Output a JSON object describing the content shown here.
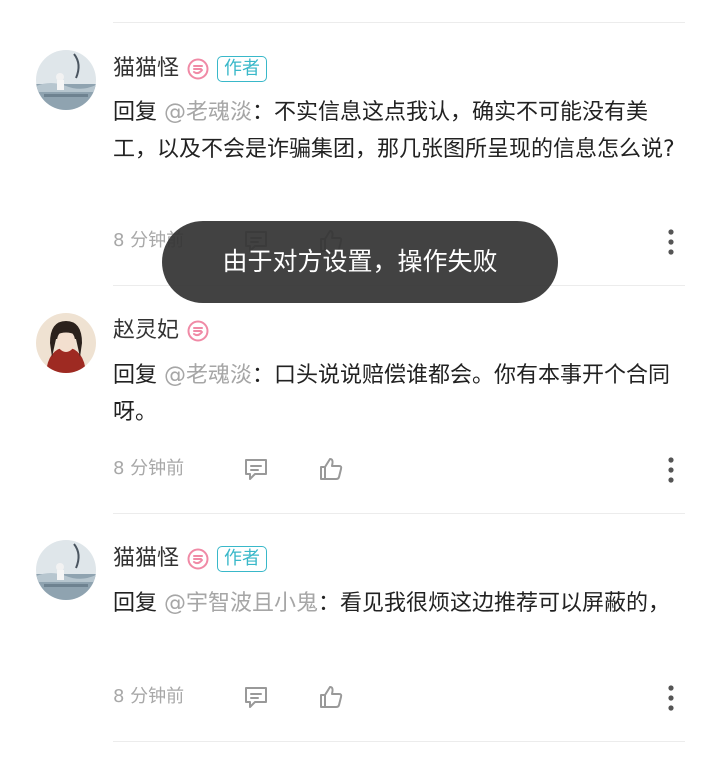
{
  "comments": [
    {
      "author": "猫猫怪",
      "author_badge": "作者",
      "reply_prefix": "回复",
      "mention": "@老魂淡",
      "text": "：不实信息这点我认，确实不可能没有美工，以及不会是诈骗集团，那几张图所呈现的信息怎么说?",
      "time": "8 分钟前"
    },
    {
      "author": "赵灵妃",
      "reply_prefix": "回复",
      "mention": "@老魂淡",
      "text": "：口头说说赔偿谁都会。你有本事开个合同呀。",
      "time": "8 分钟前"
    },
    {
      "author": "猫猫怪",
      "author_badge": "作者",
      "reply_prefix": "回复",
      "mention": "@宇智波且小鬼",
      "text": "：看见我很烦这边推荐可以屏蔽的，",
      "time": "8 分钟前"
    }
  ],
  "toast": {
    "message": "由于对方设置，操作失败"
  },
  "colors": {
    "accent": "#39b8c9",
    "level_badge": "#f08aa6",
    "mention": "#a6a6a6",
    "toast_bg": "#343434"
  },
  "icons": [
    "level-badge-icon",
    "reply-icon",
    "like-icon",
    "more-icon"
  ]
}
